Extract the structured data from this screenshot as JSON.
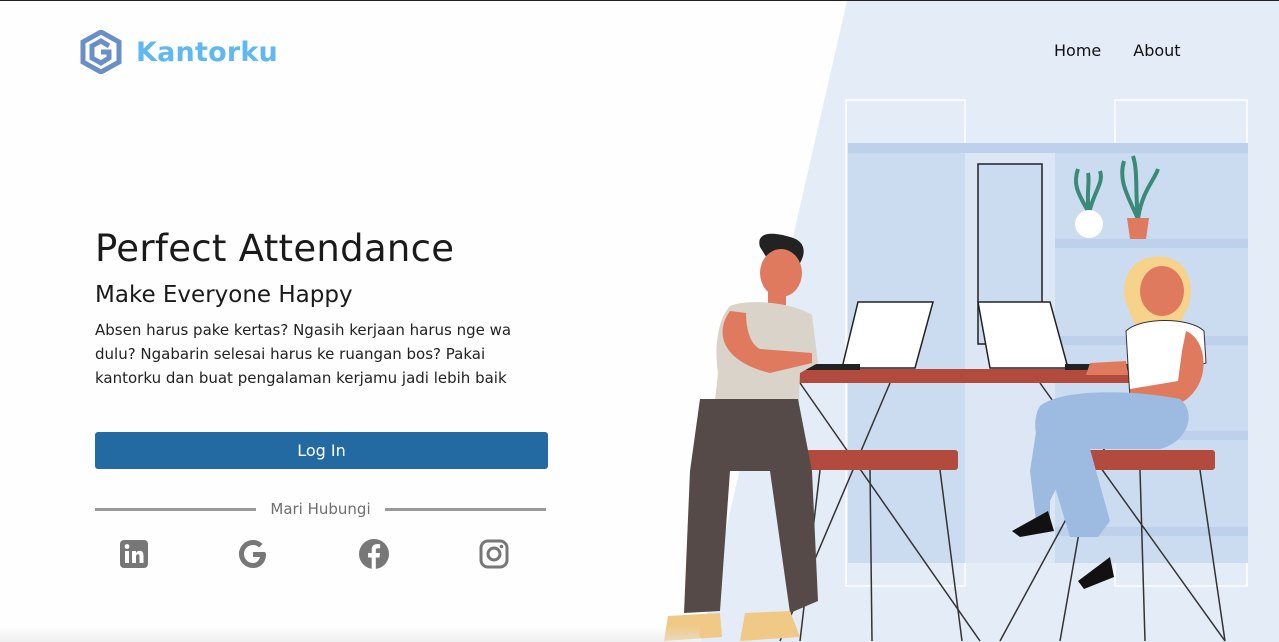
{
  "brand": {
    "name": "Kantorku",
    "color": "#5fb8f0"
  },
  "nav": {
    "home": "Home",
    "about": "About"
  },
  "hero": {
    "title": "Perfect Attendance",
    "subtitle": "Make Everyone Happy",
    "description": "Absen harus pake kertas? Ngasih kerjaan harus nge wa dulu? Ngabarin selesai harus ke ruangan bos? Pakai kantorku dan buat pengalaman kerjamu jadi lebih baik"
  },
  "login": {
    "label": "Log In",
    "color": "#236aa3"
  },
  "contact": {
    "label": "Mari Hubungi"
  },
  "socials": [
    {
      "icon": "linkedin-icon"
    },
    {
      "icon": "google-icon"
    },
    {
      "icon": "facebook-icon"
    },
    {
      "icon": "instagram-icon"
    }
  ],
  "colors": {
    "panel": "#e4ecf8",
    "window": "#ccdcf0",
    "desk": "#b24a3e"
  }
}
